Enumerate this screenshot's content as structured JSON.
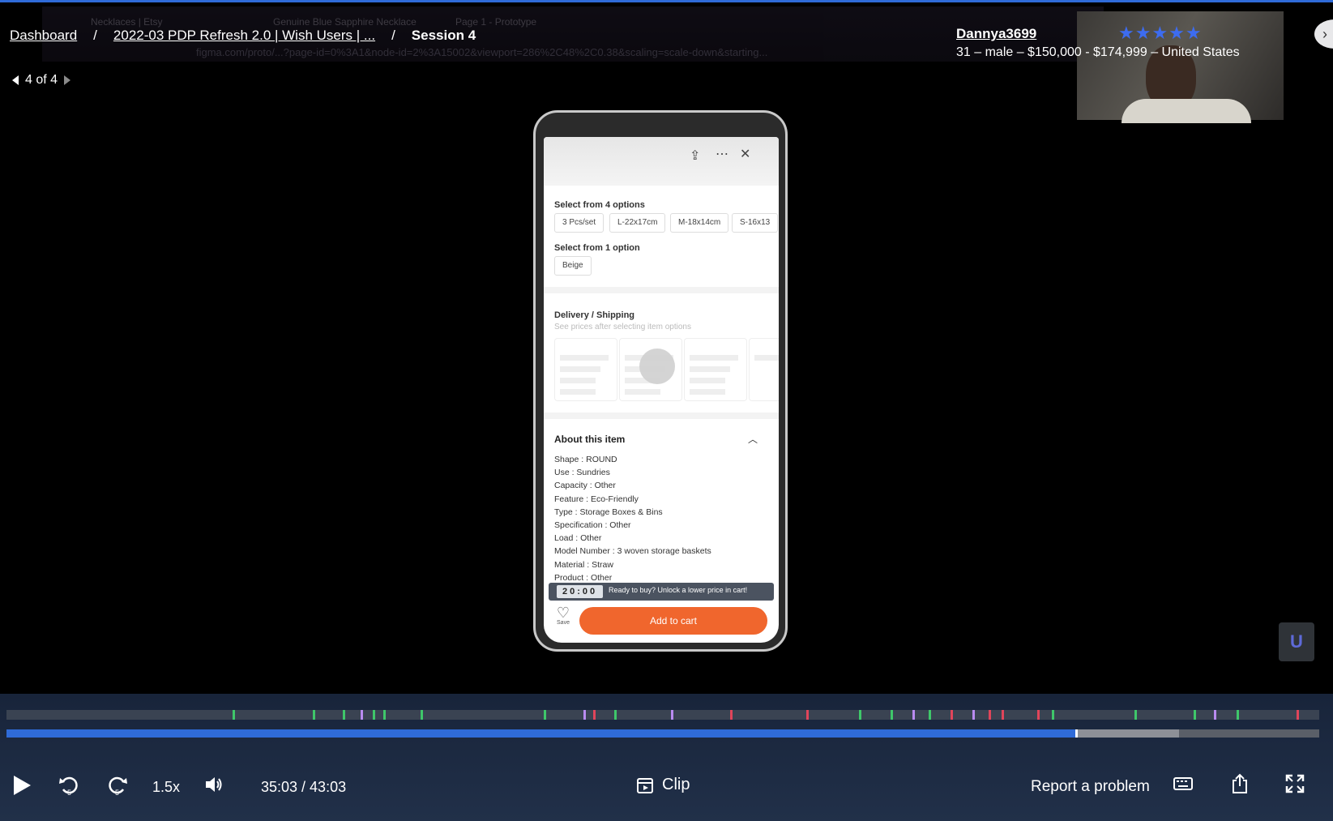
{
  "breadcrumbs": {
    "dashboard": "Dashboard",
    "study": "2022-03 PDP Refresh 2.0 | Wish Users | ...",
    "separator": "/",
    "session": "Session 4"
  },
  "pager": {
    "label": "4 of 4"
  },
  "participant": {
    "username": "Dannya3699",
    "rating_stars": "★★★★★",
    "rating": 5,
    "demographics": "31 – male – $150,000 - $174,999 – United States"
  },
  "background_browser": {
    "tabs": [
      "Necklaces | Etsy",
      "Genuine Blue Sapphire Necklace",
      "Page 1 - Prototype"
    ],
    "url": "figma.com/proto/...?page-id=0%3A1&node-id=2%3A15002&viewport=286%2C48%2C0.38&scaling=scale-down&starting..."
  },
  "phone": {
    "option_group_1_title": "Select from 4 options",
    "option_group_1": [
      "3 Pcs/set",
      "L-22x17cm",
      "M-18x14cm",
      "S-16x13"
    ],
    "option_group_2_title": "Select from 1 option",
    "option_group_2": [
      "Beige"
    ],
    "shipping_title": "Delivery / Shipping",
    "shipping_subtitle": "See prices after selecting item options",
    "about_title": "About this item",
    "specs": [
      "Shape : ROUND",
      "Use : Sundries",
      "Capacity : Other",
      "Feature : Eco-Friendly",
      "Type : Storage Boxes & Bins",
      "Specification : Other",
      "Load : Other",
      "Model Number : 3 woven storage baskets",
      "Material : Straw",
      "Product : Other"
    ],
    "timer": "20:00",
    "promo": "Ready to buy? Unlock a lower price in cart!",
    "save_label": "Save",
    "add_to_cart": "Add to cart"
  },
  "player": {
    "speed": "1.5x",
    "time": "35:03 / 43:03",
    "played_fraction": 0.814,
    "buffered_fraction": 0.893,
    "clip_label": "Clip",
    "report_label": "Report a problem",
    "colors": {
      "accent": "#2f6bd8",
      "marker_green": "#3fc76a",
      "marker_red": "#e0455a",
      "marker_purple": "#b98bf0",
      "add_to_cart": "#f0662d"
    }
  }
}
